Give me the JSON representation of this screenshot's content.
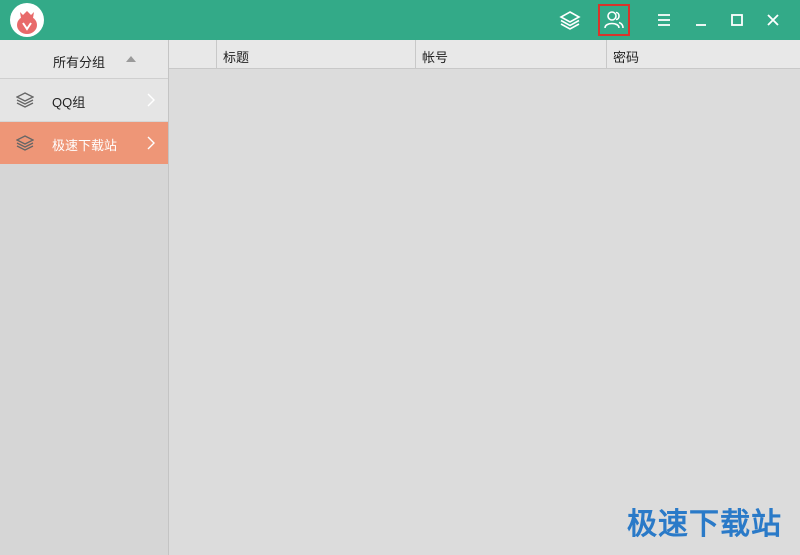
{
  "titlebar": {
    "buttons": [
      "layers-icon",
      "users-icon",
      "menu-icon",
      "minimize-icon",
      "maximize-icon",
      "close-icon"
    ],
    "highlighted_button": "users-icon"
  },
  "sidebar": {
    "header_label": "所有分组",
    "items": [
      {
        "label": "QQ组",
        "active": false
      },
      {
        "label": "极速下载站",
        "active": true
      }
    ]
  },
  "table": {
    "columns": [
      "标题",
      "帐号",
      "密码"
    ]
  },
  "watermark": "极速下载站",
  "colors": {
    "titlebar": "#33aa88",
    "active_item": "#ee9677",
    "highlight_border": "#d9342b",
    "watermark": "#2a7ac8"
  }
}
